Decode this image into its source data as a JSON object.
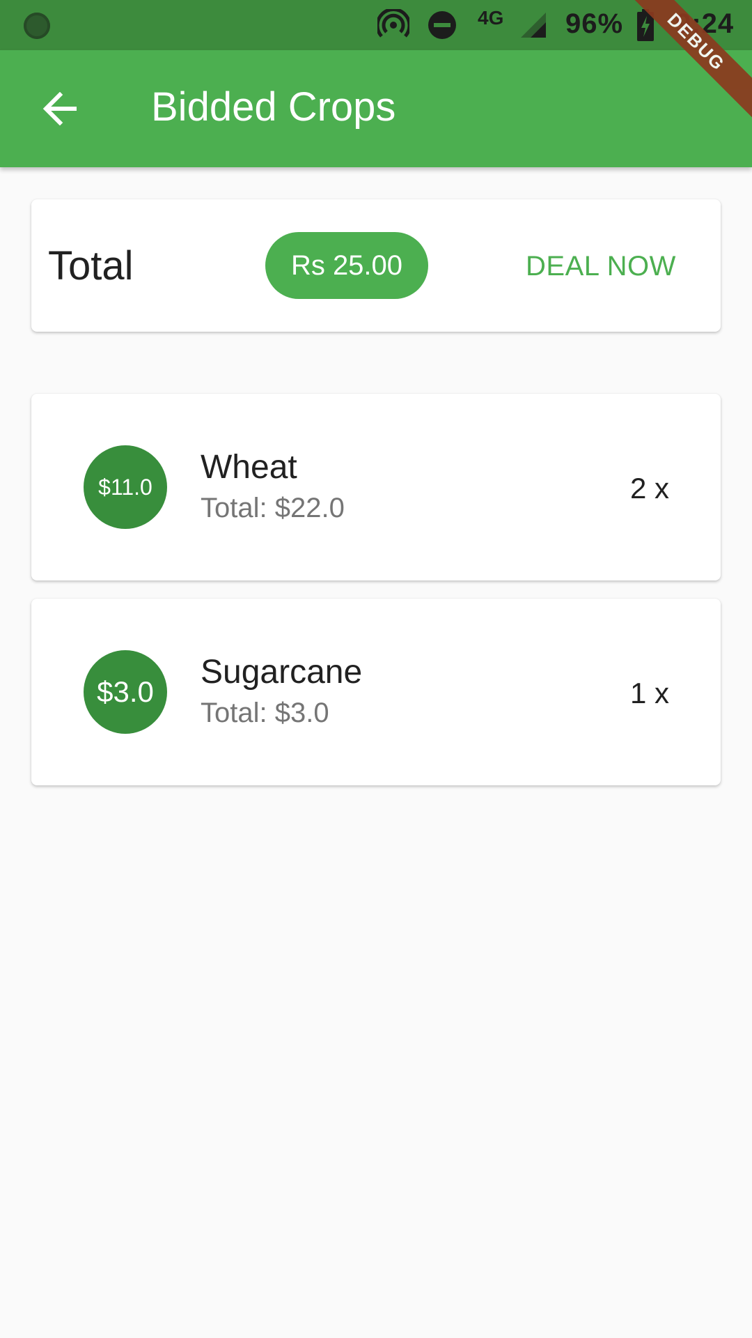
{
  "status_bar": {
    "battery": "96%",
    "time": "9:24",
    "network": "4G"
  },
  "app_bar": {
    "title": "Bidded Crops"
  },
  "debug_banner": "DEBUG",
  "summary": {
    "label": "Total",
    "amount": "Rs 25.00",
    "action_label": "DEAL NOW"
  },
  "items": [
    {
      "price": "$11.0",
      "name": "Wheat",
      "subtotal": "Total: $22.0",
      "quantity": "2 x"
    },
    {
      "price": "$3.0",
      "name": "Sugarcane",
      "subtotal": "Total: $3.0",
      "quantity": "1 x"
    }
  ],
  "colors": {
    "primary": "#4caf50",
    "primary_dark": "#388e3c",
    "status_bar": "#3d8b3d",
    "debug": "#8b3a1f"
  }
}
